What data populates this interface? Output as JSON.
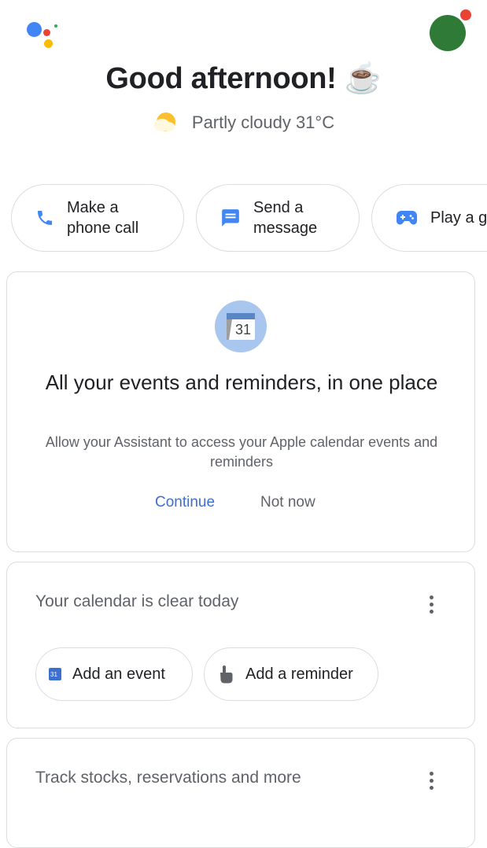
{
  "header": {
    "greeting": "Good afternoon!",
    "greeting_emoji": "☕",
    "weather_icon": "partly-cloudy-icon",
    "weather": "Partly cloudy 31°C"
  },
  "suggestions": [
    {
      "label_line1": "Make a",
      "label_line2": "phone call",
      "icon": "phone-icon"
    },
    {
      "label_line1": "Send a",
      "label_line2": "message",
      "icon": "message-icon"
    },
    {
      "label_line1": "Play a g",
      "icon": "gamepad-icon"
    }
  ],
  "calendar_access_card": {
    "icon": "calendar-icon",
    "icon_day": "31",
    "title": "All your events and reminders, in one place",
    "description": "Allow your Assistant to access your Apple calendar events and reminders",
    "continue_label": "Continue",
    "not_now_label": "Not now"
  },
  "calendar_card": {
    "title": "Your calendar is clear today",
    "add_event_label": "Add an event",
    "add_event_icon_day": "31",
    "add_reminder_label": "Add a reminder"
  },
  "stocks_card": {
    "title": "Track stocks, reservations and more"
  },
  "colors": {
    "google_blue": "#4285f4",
    "google_red": "#ea4335",
    "google_yellow": "#fbbc04",
    "google_green": "#34a853",
    "link_blue": "#3c6fd0",
    "avatar_green": "#2e7a36"
  }
}
